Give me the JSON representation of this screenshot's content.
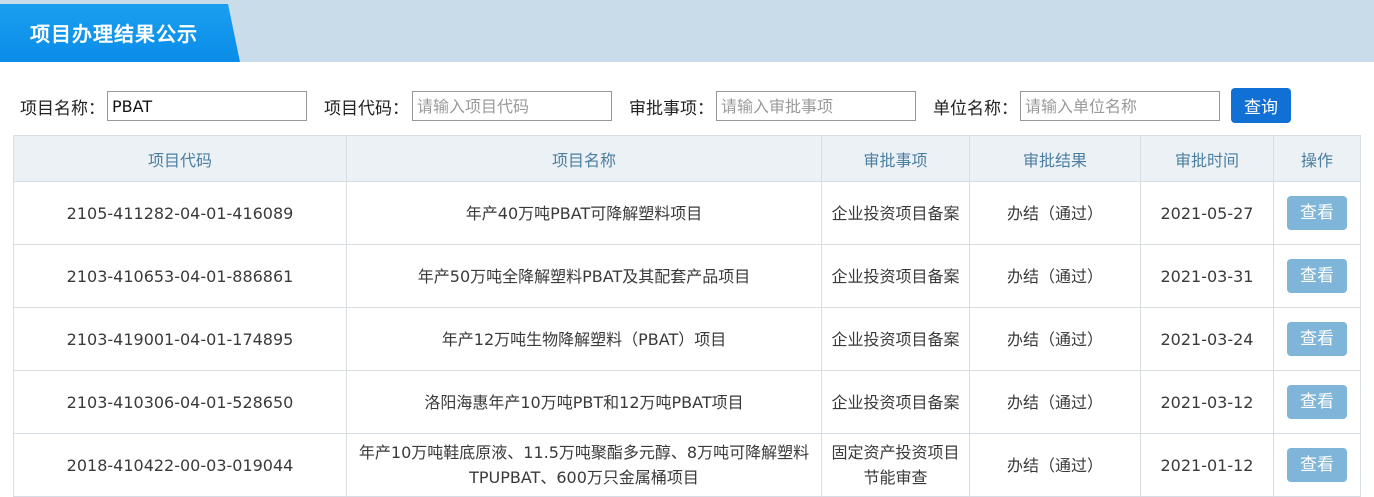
{
  "header": {
    "title": "项目办理结果公示"
  },
  "search": {
    "name_label": "项目名称：",
    "name_value": "PBAT",
    "code_label": "项目代码：",
    "code_placeholder": "请输入项目代码",
    "approval_label": "审批事项：",
    "approval_placeholder": "请输入审批事项",
    "unit_label": "单位名称：",
    "unit_placeholder": "请输入单位名称",
    "query_button": "查询"
  },
  "table": {
    "headers": [
      "项目代码",
      "项目名称",
      "审批事项",
      "审批结果",
      "审批时间",
      "操作"
    ],
    "rows": [
      {
        "code": "2105-411282-04-01-416089",
        "name": "年产40万吨PBAT可降解塑料项目",
        "item": "企业投资项目备案",
        "result": "办结（通过）",
        "date": "2021-05-27",
        "action": "查看"
      },
      {
        "code": "2103-410653-04-01-886861",
        "name": "年产50万吨全降解塑料PBAT及其配套产品项目",
        "item": "企业投资项目备案",
        "result": "办结（通过）",
        "date": "2021-03-31",
        "action": "查看"
      },
      {
        "code": "2103-419001-04-01-174895",
        "name": "年产12万吨生物降解塑料（PBAT）项目",
        "item": "企业投资项目备案",
        "result": "办结（通过）",
        "date": "2021-03-24",
        "action": "查看"
      },
      {
        "code": "2103-410306-04-01-528650",
        "name": "洛阳海惠年产10万吨PBT和12万吨PBAT项目",
        "item": "企业投资项目备案",
        "result": "办结（通过）",
        "date": "2021-03-12",
        "action": "查看"
      },
      {
        "code": "2018-410422-00-03-019044",
        "name": "年产10万吨鞋底原液、11.5万吨聚酯多元醇、8万吨可降解塑料TPUPBAT、600万只金属桶项目",
        "item": "固定资产投资项目节能审查",
        "result": "办结（通过）",
        "date": "2021-01-12",
        "action": "查看"
      }
    ]
  },
  "colors": {
    "accent": "#1170d6",
    "header_tab": "#0a8ce8",
    "header_bar": "#c9dcea",
    "view_button": "#7fb5d8"
  }
}
